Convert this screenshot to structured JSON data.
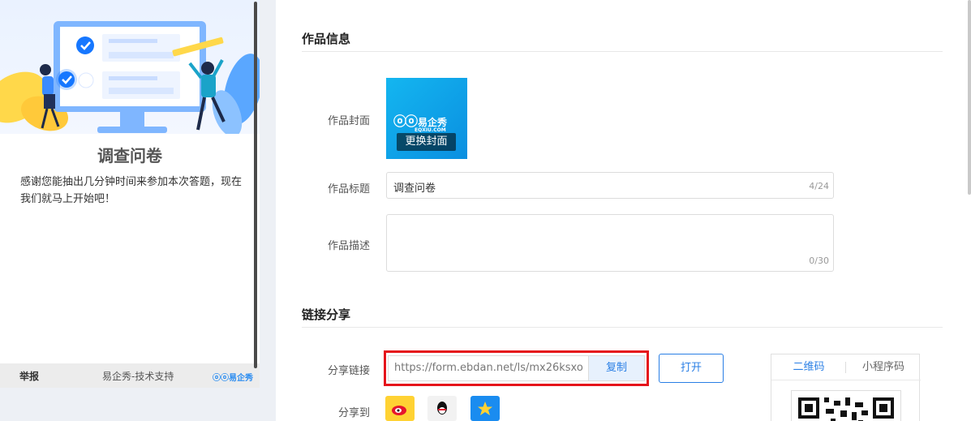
{
  "preview": {
    "title": "调查问卷",
    "description": "感谢您能抽出几分钟时间来参加本次答题，现在我们就马上开始吧！",
    "footer": {
      "report": "举报",
      "support": "易企秀-技术支持",
      "brand": "易企秀"
    }
  },
  "work_info": {
    "section_title": "作品信息",
    "cover_label": "作品封面",
    "cover_logo_text": "易企秀",
    "cover_logo_sub": "EQXIU.COM",
    "change_cover": "更换封面",
    "title_label": "作品标题",
    "title_value": "调查问卷",
    "title_count": "4/24",
    "desc_label": "作品描述",
    "desc_value": "",
    "desc_count": "0/30"
  },
  "link_share": {
    "section_title": "链接分享",
    "share_link_label": "分享链接",
    "share_url": "https://form.ebdan.net/ls/mx26ksxo",
    "copy_label": "复制",
    "open_label": "打开",
    "share_to_label": "分享到",
    "share_targets": [
      {
        "icon": "weibo-icon",
        "color": "#f5a623"
      },
      {
        "icon": "qq-icon",
        "color": "#111111"
      },
      {
        "icon": "qzone-icon",
        "color": "#2a8cf0"
      }
    ],
    "qr_tabs": [
      "二维码",
      "小程序码"
    ],
    "qr_active": "二维码"
  },
  "colors": {
    "accent": "#2a7fe5",
    "highlight_border": "#e5141b",
    "cover_bg": "#14b6f0"
  }
}
